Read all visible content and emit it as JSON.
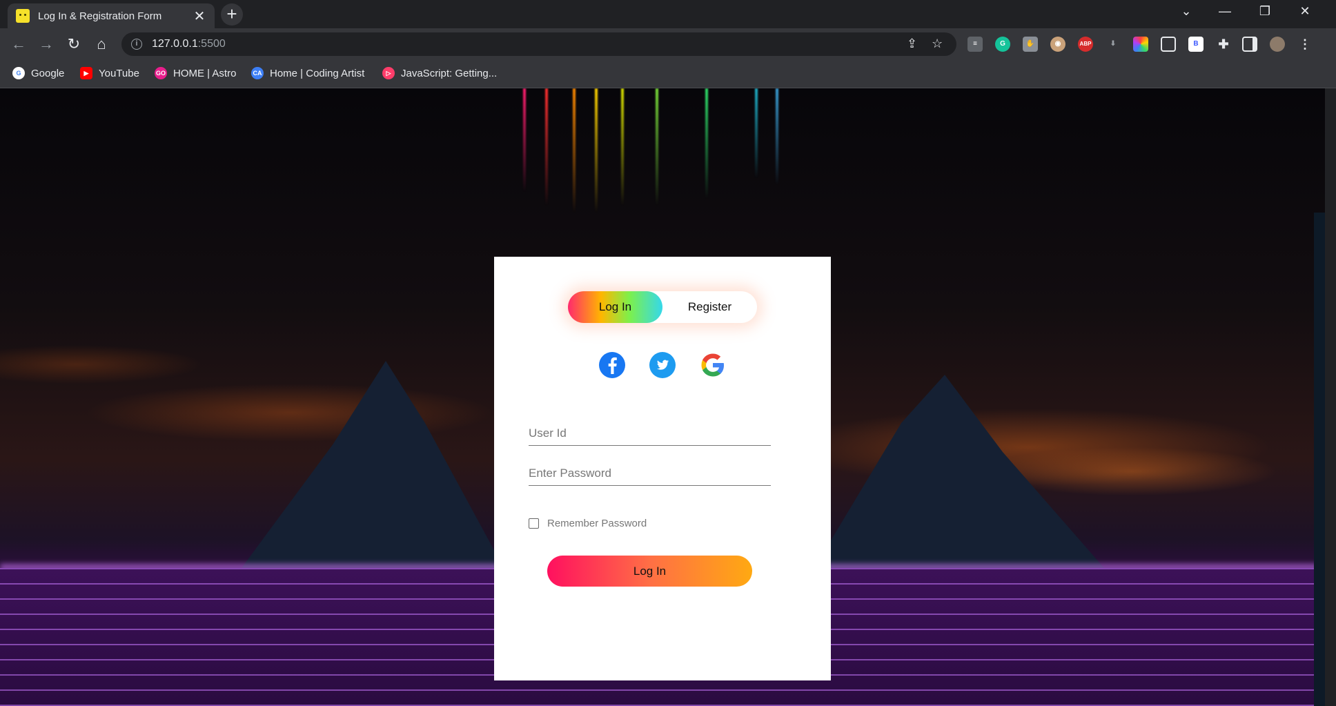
{
  "browser": {
    "tab": {
      "title": "Log In & Registration Form",
      "close": "✕"
    },
    "new_tab": "+",
    "window_controls": {
      "minimize": "—",
      "restore": "❐",
      "close": "✕"
    },
    "address": {
      "host": "127.0.0.1",
      "port": ":5500"
    },
    "bookmarks": [
      {
        "label": "Google",
        "icon": "google-icon",
        "color": "#ffffff"
      },
      {
        "label": "YouTube",
        "icon": "youtube-icon",
        "color": "#ff0000"
      },
      {
        "label": "HOME | Astro",
        "icon": "astro-icon",
        "color": "#e91e8c"
      },
      {
        "label": "Home | Coding Artist",
        "icon": "coding-artist-icon",
        "color": "#3d7ff6"
      },
      {
        "label": "JavaScript: Getting...",
        "icon": "javascript-icon",
        "color": "#ff3d6a"
      }
    ],
    "extensions": [
      {
        "name": "grammarly-icon",
        "text": "G",
        "color": "#15c39a"
      },
      {
        "name": "abp-icon",
        "text": "ABP",
        "color": "#d62c2c"
      },
      {
        "name": "b-icon",
        "text": "B",
        "color": "#ffffff"
      }
    ]
  },
  "form": {
    "tabs": {
      "login": "Log In",
      "register": "Register"
    },
    "social": [
      {
        "name": "facebook-icon",
        "color": "#1877f2"
      },
      {
        "name": "twitter-icon",
        "color": "#1d9bf0"
      },
      {
        "name": "google-icon",
        "color": "#ffffff"
      }
    ],
    "user_id_placeholder": "User Id",
    "password_placeholder": "Enter Password",
    "remember_label": "Remember Password",
    "submit_label": "Log In"
  }
}
